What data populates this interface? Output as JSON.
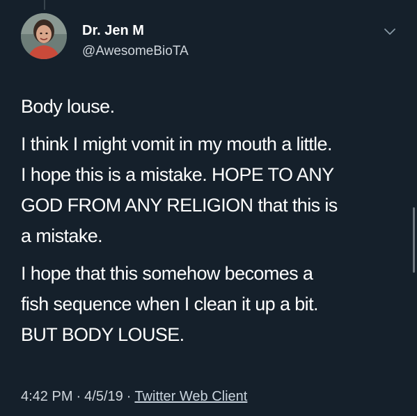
{
  "tweet": {
    "author": {
      "display_name": "Dr. Jen M",
      "handle": "@AwesomeBioTA"
    },
    "paragraphs": [
      "Body louse.",
      "I think I might vomit in my mouth a little.\nI hope this is a mistake. HOPE TO ANY\nGOD FROM ANY RELIGION that this is\na mistake.",
      "I hope that this somehow becomes a\nfish sequence when I clean it up a bit.\nBUT BODY LOUSE."
    ],
    "time": "4:42 PM",
    "date": "4/5/19",
    "separator": "·",
    "client": "Twitter Web Client",
    "caret_icon": "chevron-down-icon"
  },
  "colors": {
    "background": "#15202b",
    "text": "#ffffff",
    "secondary_text": "#d0d6dc",
    "icon": "#8899a6"
  }
}
